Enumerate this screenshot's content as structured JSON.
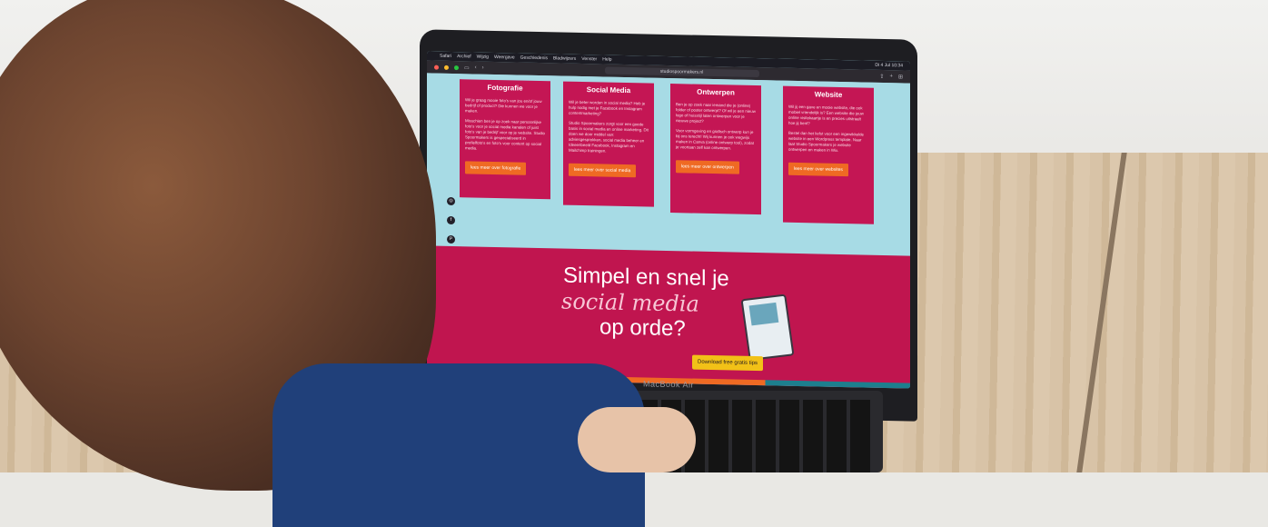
{
  "menubar": {
    "items": [
      "Safari",
      "Archief",
      "Wijzig",
      "Weergave",
      "Geschiedenis",
      "Bladwijzers",
      "Venster",
      "Help"
    ],
    "status": "Di 4 Jul 10:34"
  },
  "browser": {
    "address": "studiospoormakers.nl"
  },
  "cards": [
    {
      "title": "Fotografie",
      "text1": "Wil je graag mooie foto's van jou en/of jouw bedrijf of product? Die kunnen we voor je maken.",
      "text2": "Misschien ben je op zoek naar persoonlijke foto's voor je social media kanalen of juist foto's van je bedrijf voor op je website. Studio Spoormakers is gespecialiseerd in profielfoto's en foto's voor content op social media.",
      "cta": "lees meer over fotografie"
    },
    {
      "title": "Social Media",
      "text1": "Wil je beter worden in social media? Heb je hulp nodig met je Facebook en Instagram contentmarketing?",
      "text2": "Studio Spoormakers zorgt voor een goede basis in social media en online marketing. Dit doen we door middel van: adviesgesprekken, social media beheer en Ideeenbeeld Facebook, Instagram en Mailchimp trainingen.",
      "cta": "lees meer over social media"
    },
    {
      "title": "Ontwerpen",
      "text1": "Ben je op zoek naar iemand die je (online) folder of poster ontwerpt? Of wil je een nieuw logo of huisstijl laten ontwerpen voor je nieuwe project?",
      "text2": "Voor vormgeving en grafisch ontwerp kun je bij ons terecht! Wij kunnen je ook wegwijs maken in Canva (online ontwerp tool), zodat je voortaan zelf kan ontwerpen.",
      "cta": "lees meer over ontwerpen"
    },
    {
      "title": "Website",
      "text1": "Wil jij een gave en mooie website, die ook mobiel vriendelijk is? Een website die jouw online visitekaartje is en precies uitstraalt hoe jij bent?",
      "text2": "Bestel dan het liefst voor een ingewikkelde website in een Wordpress template. Naar laat Studio Spoormakers je website ontwerpen en maken in Wix.",
      "cta": "lees meer over websites"
    }
  ],
  "promo": {
    "line1": "Simpel en snel je",
    "script": "social media",
    "line2": "op orde?",
    "button": "Download free gratis tips"
  },
  "laptop": {
    "label": "MacBook Air"
  },
  "colors": {
    "magenta": "#c0154f",
    "orange": "#ef6a23",
    "sky": "#a7dbe5",
    "yellow": "#f2c117"
  }
}
